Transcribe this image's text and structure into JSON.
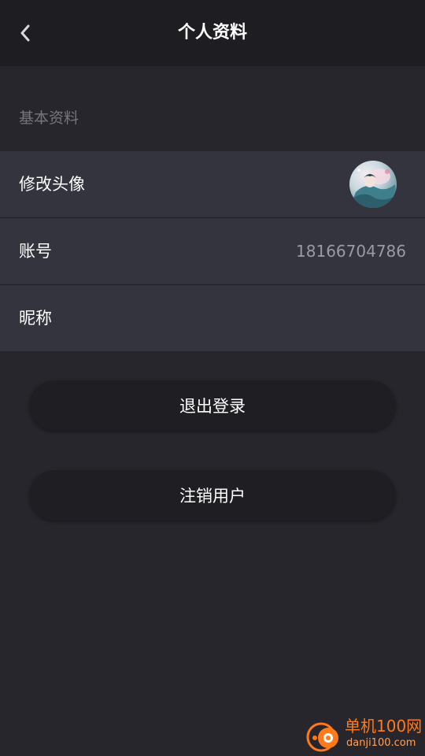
{
  "header": {
    "title": "个人资料",
    "back_icon": "chevron-left-icon"
  },
  "section": {
    "label": "基本资料"
  },
  "rows": {
    "avatar": {
      "label": "修改头像",
      "image": "avatar-image"
    },
    "account": {
      "label": "账号",
      "value": "18166704786"
    },
    "nickname": {
      "label": "昵称",
      "value": ""
    }
  },
  "buttons": {
    "logout": "退出登录",
    "deregister": "注销用户"
  },
  "watermark": {
    "text": "单机100网",
    "url": "danji100.com"
  },
  "colors": {
    "background": "#26262c",
    "header": "#1e1e22",
    "row": "#34343e",
    "button": "#1f1f23",
    "text": "#ffffff",
    "muted": "#76767e",
    "value": "#9a9aa2",
    "watermark": "#ff7a1a"
  }
}
